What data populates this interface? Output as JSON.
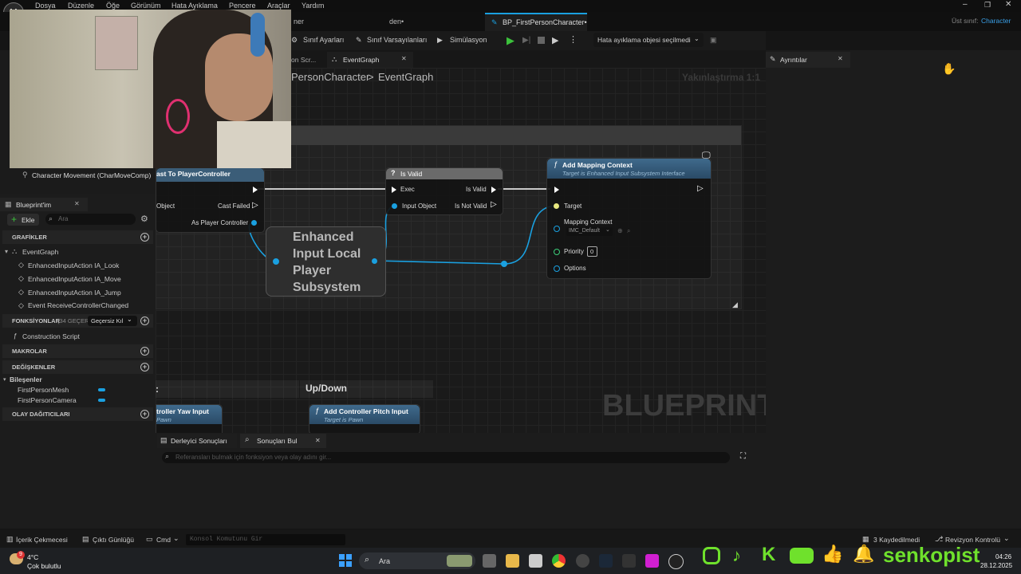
{
  "menu": [
    "Dosya",
    "Düzenle",
    "Öğe",
    "Görünüm",
    "Hata Ayıklama",
    "Pencere",
    "Araçlar",
    "Yardım"
  ],
  "doc_tabs": {
    "tab1": "ner",
    "tab2": "den•",
    "tab3": "BP_FirstPersonCharacter•"
  },
  "parent_class": {
    "label": "Üst sınıf:",
    "value": "Character"
  },
  "toolbar": {
    "class_settings": "Sınıf Ayarları",
    "class_defaults": "Sınıf Varsayılanları",
    "simulation": "Simülasyon",
    "debug_select": "Hata ayıklama objesi seçilmedi"
  },
  "graph_tabs": {
    "construction": "on Scr...",
    "eventgraph": "EventGraph"
  },
  "breadcrumb": {
    "parent": "PersonCharacter",
    "sep": ">",
    "current": "EventGraph"
  },
  "zoom_label": "Yakınlaştırma 1:1",
  "watermark": "BLUEPRINT",
  "details_tab": "Ayrıntılar",
  "component_item": "Character Movement (CharMoveComp)",
  "my_blueprint": {
    "title": "Blueprint'im",
    "add_label": "Ekle",
    "search_placeholder": "Ara",
    "graphs_header": "GRAFİKLER",
    "graphs": [
      "EventGraph",
      "EnhancedInputAction IA_Look",
      "EnhancedInputAction IA_Move",
      "EnhancedInputAction IA_Jump",
      "Event ReceiveControllerChanged"
    ],
    "functions_header": "FONKSİYONLAR",
    "functions_count": "(34 GEÇERSİ",
    "override_label": "Geçersiz Kıl",
    "functions": [
      "Construction Script"
    ],
    "macros_header": "MAKROLAR",
    "variables_header": "DEĞİŞKENLER",
    "components_category": "Bileşenler",
    "variables": [
      "FirstPersonMesh",
      "FirstPersonCamera"
    ],
    "dispatchers_header": "OLAY DAĞITICILARI"
  },
  "nodes": {
    "cast": {
      "title": "ast To PlayerController",
      "object": "Object",
      "cast_failed": "Cast Failed",
      "as_pc": "As Player Controller"
    },
    "isvalid": {
      "title": "Is Valid",
      "exec": "Exec",
      "is_valid": "Is Valid",
      "input_object": "Input Object",
      "is_not_valid": "Is Not Valid"
    },
    "enhanced": {
      "title": "Enhanced Input Local Player Subsystem"
    },
    "addmapping": {
      "title": "Add Mapping Context",
      "subtitle": "Target is Enhanced Input Subsystem Interface",
      "target": "Target",
      "mapping": "Mapping Context",
      "mapping_value": "IMC_Default",
      "priority": "Priority",
      "priority_value": "0",
      "options": "Options"
    },
    "yaw": {
      "title": "troller Yaw Input",
      "subtitle": "Pawn"
    },
    "pitch": {
      "title": "Add Controller Pitch Input",
      "subtitle": "Target is Pawn"
    }
  },
  "comment_updown": "Up/Down",
  "comment_left": ":",
  "bottom_tabs": {
    "compiler": "Derleyici Sonuçları",
    "find": "Sonuçları Bul"
  },
  "find_placeholder": "Referansları bulmak için fonksiyon veya olay adını gir...",
  "status": {
    "content_drawer": "İçerik Çekmecesi",
    "output_log": "Çıktı Günlüğü",
    "cmd": "Cmd",
    "console_placeholder": "Konsol Komutunu Gir",
    "saved": "3 Kaydedilmedi",
    "revision": "Revizyon Kontrolü"
  },
  "taskbar": {
    "temp": "4°C",
    "weather": "Çok bulutlu",
    "weather_badge": "9",
    "search": "Ara",
    "brand": "senkopist",
    "time": "04:26",
    "date": "28.12.2025"
  },
  "colors": {
    "accent": "#1aa0e0",
    "function_head": "#2d4f6e",
    "green": "#6fe12c"
  }
}
